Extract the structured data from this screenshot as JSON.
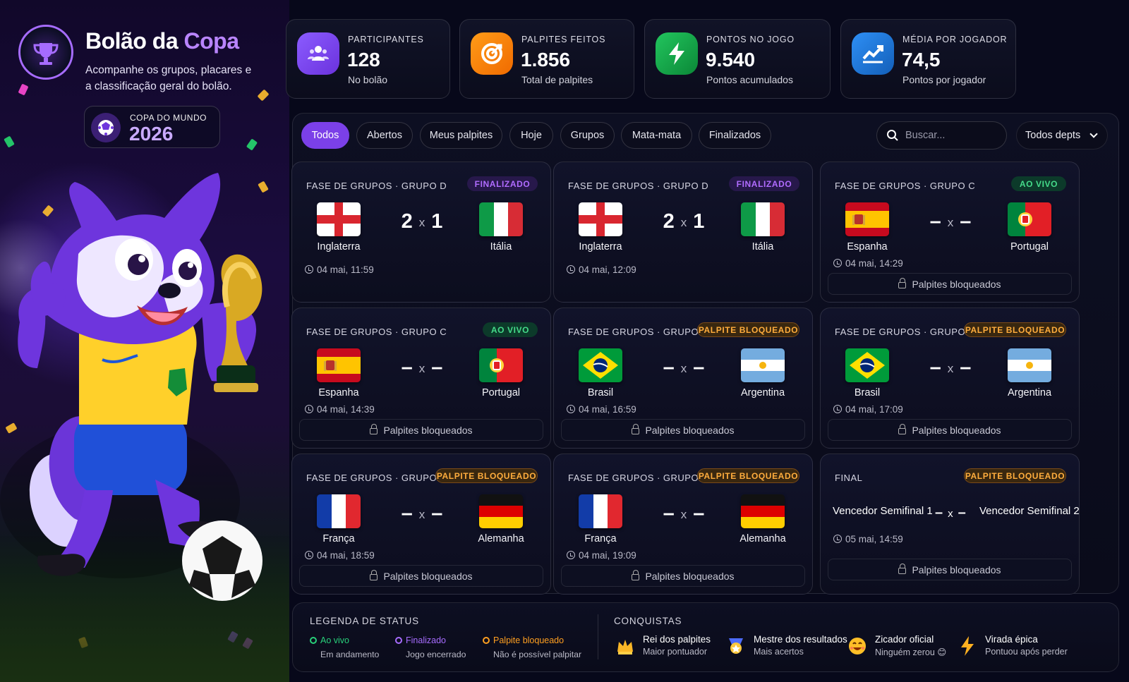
{
  "app": {
    "title_main": "Bolão da ",
    "title_accent": "Copa",
    "subtitle": "Acompanhe os grupos, placares e a classificação geral do bolão."
  },
  "badge": {
    "label": "COPA DO MUNDO",
    "year": "2026"
  },
  "stats": [
    {
      "label": "PARTICIPANTES",
      "value": "128",
      "caption": "No bolão",
      "icon": "users-icon",
      "color": "#7c4dff"
    },
    {
      "label": "PALPITES FEITOS",
      "value": "1.856",
      "caption": "Total de palpites",
      "icon": "target-icon",
      "color": "#ff7a00"
    },
    {
      "label": "PONTOS NO JOGO",
      "value": "9.540",
      "caption": "Pontos acumulados",
      "icon": "lightning-icon",
      "color": "#16a34a"
    },
    {
      "label": "MÉDIA POR JOGADOR",
      "value": "74,5",
      "caption": "Pontos por jogador",
      "icon": "trend-up-icon",
      "color": "#1d6fd1"
    }
  ],
  "tabs": [
    "Todos",
    "Abertos",
    "Meus palpites",
    "Hoje",
    "Grupos",
    "Mata-mata",
    "Finalizados"
  ],
  "search": {
    "placeholder": "Buscar..."
  },
  "department": {
    "selected": "Todos depts"
  },
  "common": {
    "locked": "Palpites bloqueados",
    "x": "x",
    "dash": "–"
  },
  "matches": [
    {
      "phase": "FASE DE GRUPOS · GRUPO D",
      "status": "FINALIZADO",
      "status_type": "finalized",
      "home": "Inglaterra",
      "away": "Itália",
      "home_flag": "england",
      "away_flag": "italy",
      "home_score": "2",
      "away_score": "1",
      "time": "04 mai, 11:59",
      "locked": false
    },
    {
      "phase": "FASE DE GRUPOS · GRUPO D",
      "status": "FINALIZADO",
      "status_type": "finalized",
      "home": "Inglaterra",
      "away": "Itália",
      "home_flag": "england",
      "away_flag": "italy",
      "home_score": "2",
      "away_score": "1",
      "time": "04 mai, 12:09",
      "locked": false
    },
    {
      "phase": "FASE DE GRUPOS · GRUPO C",
      "status": "AO VIVO",
      "status_type": "live",
      "home": "Espanha",
      "away": "Portugal",
      "home_flag": "spain",
      "away_flag": "portugal",
      "home_score": "–",
      "away_score": "–",
      "time": "04 mai, 14:29",
      "locked": true
    },
    {
      "phase": "FASE DE GRUPOS · GRUPO C",
      "status": "AO VIVO",
      "status_type": "live",
      "home": "Espanha",
      "away": "Portugal",
      "home_flag": "spain",
      "away_flag": "portugal",
      "home_score": "–",
      "away_score": "–",
      "time": "04 mai, 14:39",
      "locked": true
    },
    {
      "phase": "FASE DE GRUPOS · GRUPO A",
      "status": "PALPITE BLOQUEADO",
      "status_type": "blocked",
      "home": "Brasil",
      "away": "Argentina",
      "home_flag": "brazil",
      "away_flag": "argentina",
      "home_score": "–",
      "away_score": "–",
      "time": "04 mai, 16:59",
      "locked": true
    },
    {
      "phase": "FASE DE GRUPOS · GRUPO A",
      "status": "PALPITE BLOQUEADO",
      "status_type": "blocked",
      "home": "Brasil",
      "away": "Argentina",
      "home_flag": "brazil",
      "away_flag": "argentina",
      "home_score": "–",
      "away_score": "–",
      "time": "04 mai, 17:09",
      "locked": true
    },
    {
      "phase": "FASE DE GRUPOS · GRUPO B",
      "status": "PALPITE BLOQUEADO",
      "status_type": "blocked",
      "home": "França",
      "away": "Alemanha",
      "home_flag": "france",
      "away_flag": "germany",
      "home_score": "–",
      "away_score": "–",
      "time": "04 mai, 18:59",
      "locked": true
    },
    {
      "phase": "FASE DE GRUPOS · GRUPO B",
      "status": "PALPITE BLOQUEADO",
      "status_type": "blocked",
      "home": "França",
      "away": "Alemanha",
      "home_flag": "france",
      "away_flag": "germany",
      "home_score": "–",
      "away_score": "–",
      "time": "04 mai, 19:09",
      "locked": true
    },
    {
      "phase": "FINAL",
      "status": "PALPITE BLOQUEADO",
      "status_type": "blocked",
      "home": "Vencedor Semifinal 1",
      "away": "Vencedor Semifinal 2",
      "home_flag": "",
      "away_flag": "",
      "home_score": "–",
      "away_score": "–",
      "time": "05 mai, 14:59",
      "locked": true
    }
  ],
  "legend": {
    "title": "LEGENDA DE STATUS",
    "items": [
      {
        "title": "Ao vivo",
        "desc": "Em andamento",
        "color": "#28d07a"
      },
      {
        "title": "Finalizado",
        "desc": "Jogo encerrado",
        "color": "#a76cff"
      },
      {
        "title": "Palpite bloqueado",
        "desc": "Não é possível palpitar",
        "color": "#ff9f20"
      }
    ]
  },
  "achievements": {
    "title": "CONQUISTAS",
    "items": [
      {
        "title": "Rei dos palpites",
        "desc": "Maior pontuador",
        "icon": "crown-icon"
      },
      {
        "title": "Mestre dos resultados",
        "desc": "Mais acertos",
        "icon": "medal-icon"
      },
      {
        "title": "Zicador oficial",
        "desc": "Ninguém zerou 😊",
        "icon": "smile-icon"
      },
      {
        "title": "Virada épica",
        "desc": "Pontuou após perder",
        "icon": "lightning-icon"
      }
    ]
  }
}
